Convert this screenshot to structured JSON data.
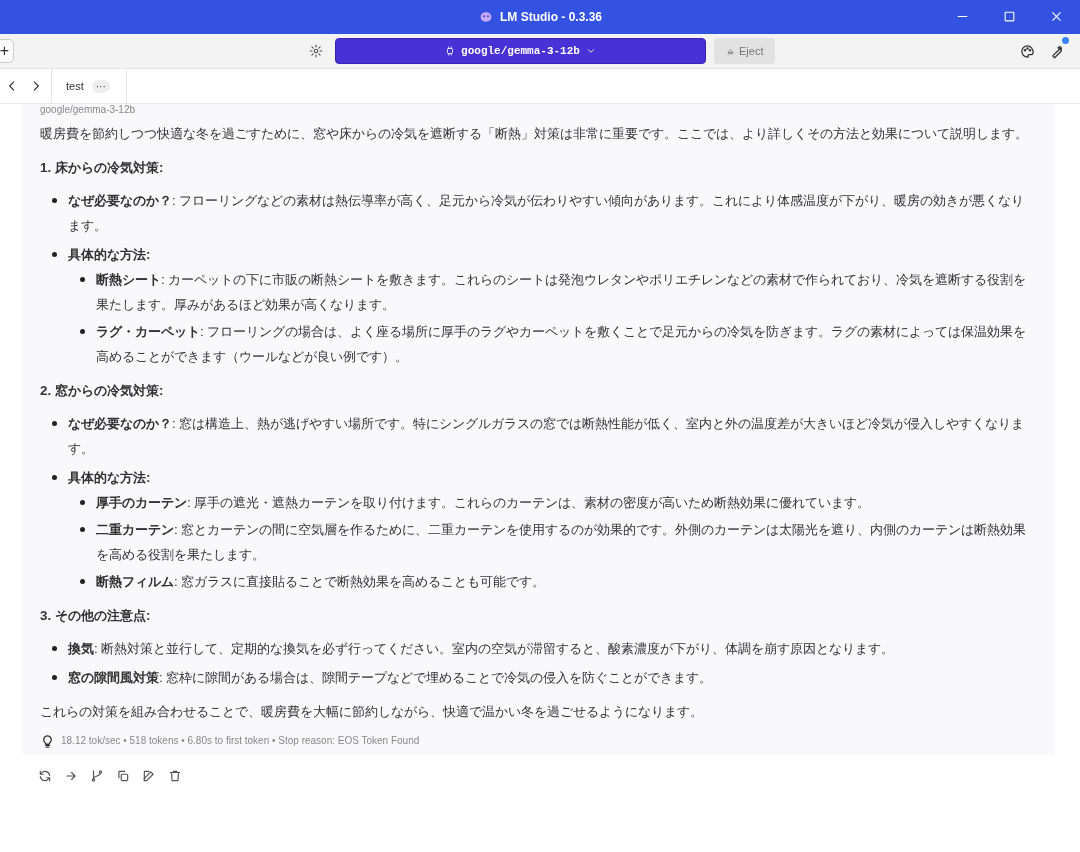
{
  "window": {
    "title": "LM Studio - 0.3.36"
  },
  "toolbar": {
    "new_button": "+",
    "model": "google/gemma-3-12b",
    "eject": "Eject"
  },
  "tabs": [
    {
      "label": "test",
      "selected": true,
      "menu": "···"
    }
  ],
  "message": {
    "sender": "google/gemma-3-12b",
    "intro": "暖房費を節約しつつ快適な冬を過ごすために、窓や床からの冷気を遮断する「断熱」対策は非常に重要です。ここでは、より詳しくその方法と効果について説明します。",
    "sections": [
      {
        "heading": "1. 床からの冷気対策:",
        "items": [
          {
            "text": "**なぜ必要なのか？**: フローリングなどの素材は熱伝導率が高く、足元から冷気が伝わりやすい傾向があります。これにより体感温度が下がり、暖房の効きが悪くなります。"
          },
          {
            "text": "**具体的な方法:**",
            "children": [
              {
                "text": "**断熱シート**: カーペットの下に市販の断熱シートを敷きます。これらのシートは発泡ウレタンやポリエチレンなどの素材で作られており、冷気を遮断する役割を果たします。厚みがあるほど効果が高くなります。"
              },
              {
                "text": "**ラグ・カーペット**: フローリングの場合は、よく座る場所に厚手のラグやカーペットを敷くことで足元からの冷気を防ぎます。ラグの素材によっては保温効果を高めることができます（ウールなどが良い例です）。"
              }
            ]
          }
        ]
      },
      {
        "heading": "2. 窓からの冷気対策:",
        "items": [
          {
            "text": "**なぜ必要なのか？**: 窓は構造上、熱が逃げやすい場所です。特にシングルガラスの窓では断熱性能が低く、室内と外の温度差が大きいほど冷気が侵入しやすくなります。"
          },
          {
            "text": "**具体的な方法:**",
            "children": [
              {
                "text": "**厚手のカーテン**: 厚手の遮光・遮熱カーテンを取り付けます。これらのカーテンは、素材の密度が高いため断熱効果に優れています。"
              },
              {
                "text": "**二重カーテン**: 窓とカーテンの間に空気層を作るために、二重カーテンを使用するのが効果的です。外側のカーテンは太陽光を遮り、内側のカーテンは断熱効果を高める役割を果たします。"
              },
              {
                "text": "**断熱フィルム**: 窓ガラスに直接貼ることで断熱効果を高めることも可能です。"
              }
            ]
          }
        ]
      },
      {
        "heading": "3. その他の注意点:",
        "items": [
          {
            "text": "**換気**: 断熱対策と並行して、定期的な換気を必ず行ってください。室内の空気が滞留すると、酸素濃度が下がり、体調を崩す原因となります。"
          },
          {
            "text": "**窓の隙間風対策**: 窓枠に隙間がある場合は、隙間テープなどで埋めることで冷気の侵入を防ぐことができます。"
          }
        ]
      }
    ],
    "conclusion": "これらの対策を組み合わせることで、暖房費を大幅に節約しながら、快適で温かい冬を過ごせるようになります。",
    "stats": "18.12 tok/sec • 518 tokens • 6.80s to first token • Stop reason: EOS Token Found"
  }
}
